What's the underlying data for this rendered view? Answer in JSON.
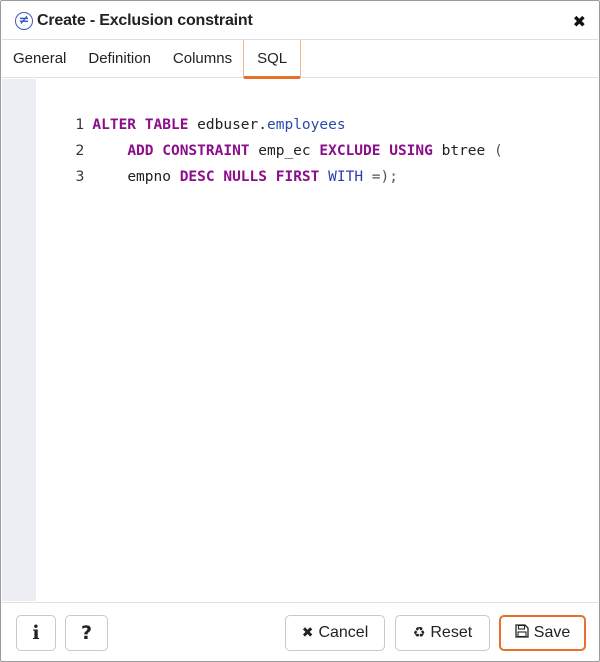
{
  "dialog": {
    "title": "Create - Exclusion constraint",
    "title_icon": "not-equal-icon",
    "close_icon": "close-icon"
  },
  "tabs": [
    {
      "label": "General",
      "active": false
    },
    {
      "label": "Definition",
      "active": false
    },
    {
      "label": "Columns",
      "active": false
    },
    {
      "label": "SQL",
      "active": true
    }
  ],
  "editor": {
    "lines": [
      {
        "number": "1"
      },
      {
        "number": "2"
      },
      {
        "number": "3"
      }
    ],
    "tokens": {
      "l1_kw": "ALTER TABLE",
      "l1_schema": " edbuser.",
      "l1_table": "employees",
      "l2_indent": "    ",
      "l2_kw1": "ADD CONSTRAINT",
      "l2_name": " emp_ec ",
      "l2_kw2": "EXCLUDE USING",
      "l2_method": " btree ",
      "l2_paren": "(",
      "l3_indent": "    ",
      "l3_col": "empno ",
      "l3_kw1": "DESC NULLS FIRST",
      "l3_sp": " ",
      "l3_kw2": "WITH",
      "l3_end": " =);"
    }
  },
  "footer": {
    "info_label": "i",
    "help_label": "?",
    "cancel_label": "Cancel",
    "cancel_icon": "✖",
    "reset_label": "Reset",
    "reset_icon": "♻",
    "save_label": "Save",
    "save_icon": "🖫"
  },
  "colors": {
    "accent": "#e8702a",
    "keyword": "#8b0f8b",
    "identifier": "#2b4aa8"
  }
}
